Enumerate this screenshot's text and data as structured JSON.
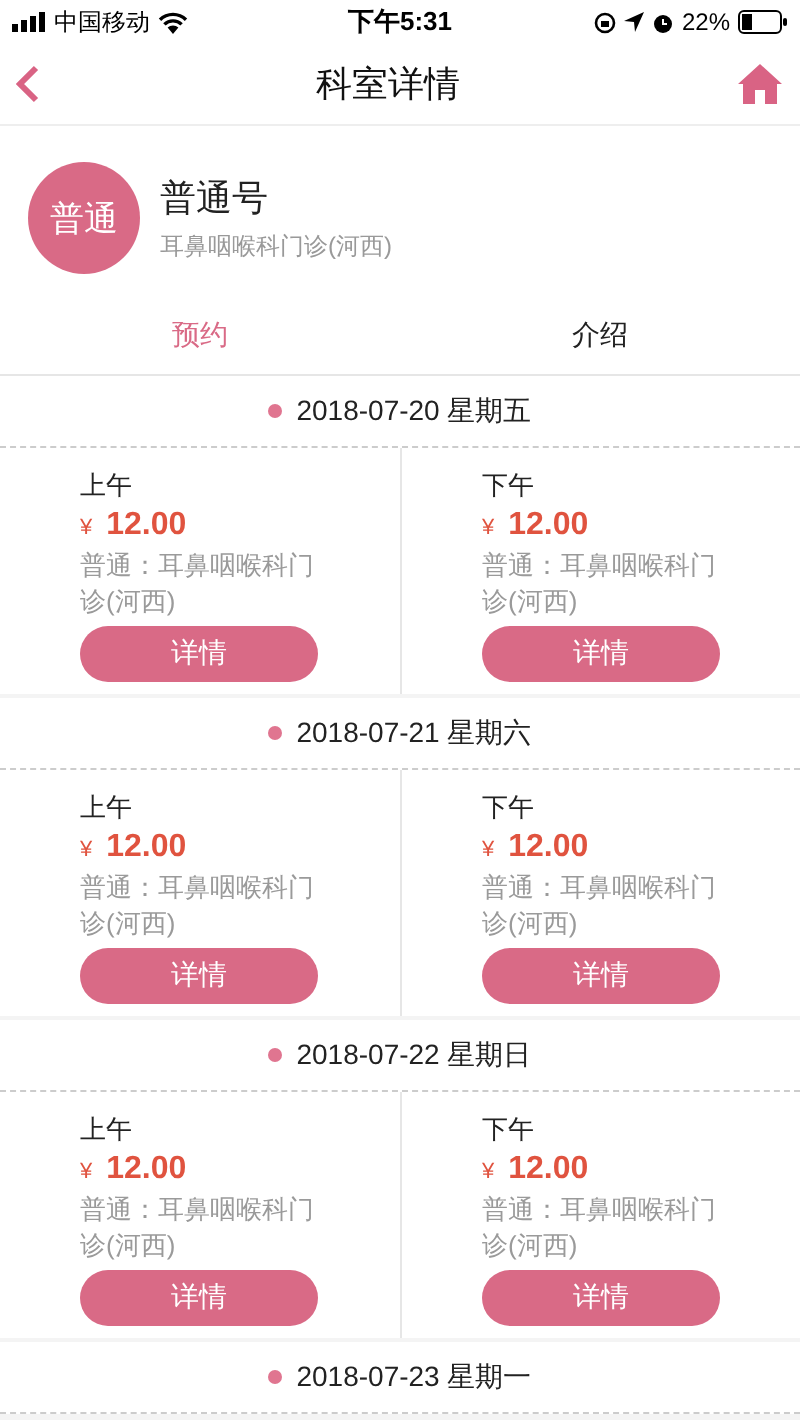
{
  "status_bar": {
    "carrier": "中国移动",
    "time": "下午5:31",
    "battery": "22%"
  },
  "nav": {
    "title": "科室详情"
  },
  "clinic": {
    "avatar": "普通",
    "name": "普通号",
    "department": "耳鼻咽喉科门诊(河西)"
  },
  "tabs": [
    {
      "label": "预约",
      "selected": true
    },
    {
      "label": "介绍",
      "selected": false
    }
  ],
  "days": [
    {
      "date": "2018-07-20 星期五",
      "slots": [
        {
          "period": "上午",
          "currency": "¥",
          "price": "12.00",
          "description": "普通：耳鼻咽喉科门诊(河西)",
          "button": "详情"
        },
        {
          "period": "下午",
          "currency": "¥",
          "price": "12.00",
          "description": "普通：耳鼻咽喉科门诊(河西)",
          "button": "详情"
        }
      ]
    },
    {
      "date": "2018-07-21 星期六",
      "slots": [
        {
          "period": "上午",
          "currency": "¥",
          "price": "12.00",
          "description": "普通：耳鼻咽喉科门诊(河西)",
          "button": "详情"
        },
        {
          "period": "下午",
          "currency": "¥",
          "price": "12.00",
          "description": "普通：耳鼻咽喉科门诊(河西)",
          "button": "详情"
        }
      ]
    },
    {
      "date": "2018-07-22 星期日",
      "slots": [
        {
          "period": "上午",
          "currency": "¥",
          "price": "12.00",
          "description": "普通：耳鼻咽喉科门诊(河西)",
          "button": "详情"
        },
        {
          "period": "下午",
          "currency": "¥",
          "price": "12.00",
          "description": "普通：耳鼻咽喉科门诊(河西)",
          "button": "详情"
        }
      ]
    },
    {
      "date": "2018-07-23 星期一"
    }
  ]
}
